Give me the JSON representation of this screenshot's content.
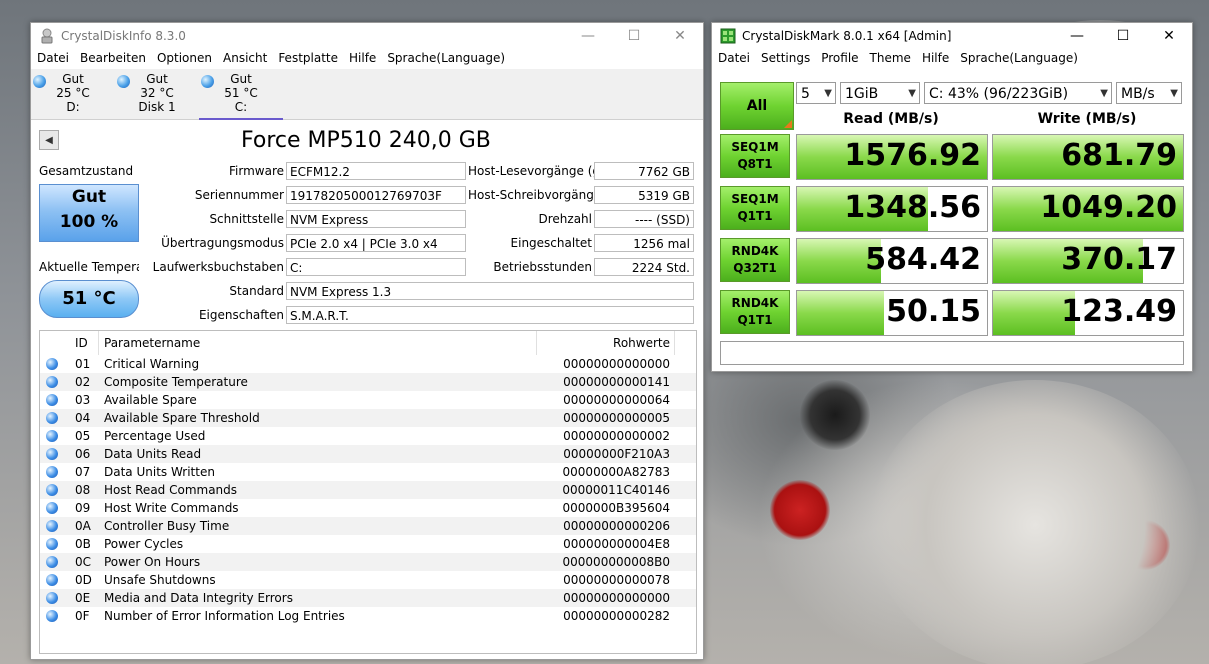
{
  "cdi": {
    "title": "CrystalDiskInfo 8.3.0",
    "menu": [
      "Datei",
      "Bearbeiten",
      "Optionen",
      "Ansicht",
      "Festplatte",
      "Hilfe",
      "Sprache(Language)"
    ],
    "disks": [
      {
        "status": "Gut",
        "temp": "25 °C",
        "name": "D:"
      },
      {
        "status": "Gut",
        "temp": "32 °C",
        "name": "Disk 1"
      },
      {
        "status": "Gut",
        "temp": "51 °C",
        "name": "C:"
      }
    ],
    "drive_title": "Force MP510 240,0 GB",
    "health_label": "Gesamtzustand",
    "health_status": "Gut",
    "health_percent": "100 %",
    "temp_label": "Aktuelle Temperatur",
    "temp_value": "51 °C",
    "fields_left": [
      {
        "label": "Firmware",
        "value": "ECFM12.2"
      },
      {
        "label": "Seriennummer",
        "value": "1917820500012769703F"
      },
      {
        "label": "Schnittstelle",
        "value": "NVM Express"
      },
      {
        "label": "Übertragungsmodus",
        "value": "PCIe 2.0 x4 | PCIe 3.0 x4"
      },
      {
        "label": "Laufwerksbuchstaben",
        "value": "C:"
      }
    ],
    "fields_right": [
      {
        "label": "Host-Lesevorgänge (gesamt)",
        "value": "7762 GB"
      },
      {
        "label": "Host-Schreibvorgänge (gesamt)",
        "value": "5319 GB"
      },
      {
        "label": "Drehzahl",
        "value": "---- (SSD)"
      },
      {
        "label": "Eingeschaltet",
        "value": "1256 mal"
      },
      {
        "label": "Betriebsstunden",
        "value": "2224 Std."
      }
    ],
    "standard_label": "Standard",
    "standard_value": "NVM Express 1.3",
    "features_label": "Eigenschaften",
    "features_value": "S.M.A.R.T.",
    "table_headers": {
      "id": "ID",
      "name": "Parametername",
      "raw": "Rohwerte"
    },
    "attributes": [
      {
        "id": "01",
        "name": "Critical Warning",
        "raw": "00000000000000"
      },
      {
        "id": "02",
        "name": "Composite Temperature",
        "raw": "00000000000141"
      },
      {
        "id": "03",
        "name": "Available Spare",
        "raw": "00000000000064"
      },
      {
        "id": "04",
        "name": "Available Spare Threshold",
        "raw": "00000000000005"
      },
      {
        "id": "05",
        "name": "Percentage Used",
        "raw": "00000000000002"
      },
      {
        "id": "06",
        "name": "Data Units Read",
        "raw": "00000000F210A3"
      },
      {
        "id": "07",
        "name": "Data Units Written",
        "raw": "00000000A82783"
      },
      {
        "id": "08",
        "name": "Host Read Commands",
        "raw": "00000011C40146"
      },
      {
        "id": "09",
        "name": "Host Write Commands",
        "raw": "0000000B395604"
      },
      {
        "id": "0A",
        "name": "Controller Busy Time",
        "raw": "00000000000206"
      },
      {
        "id": "0B",
        "name": "Power Cycles",
        "raw": "000000000004E8"
      },
      {
        "id": "0C",
        "name": "Power On Hours",
        "raw": "000000000008B0"
      },
      {
        "id": "0D",
        "name": "Unsafe Shutdowns",
        "raw": "00000000000078"
      },
      {
        "id": "0E",
        "name": "Media and Data Integrity Errors",
        "raw": "00000000000000"
      },
      {
        "id": "0F",
        "name": "Number of Error Information Log Entries",
        "raw": "00000000000282"
      }
    ]
  },
  "cdm": {
    "title": "CrystalDiskMark 8.0.1 x64 [Admin]",
    "menu": [
      "Datei",
      "Settings",
      "Profile",
      "Theme",
      "Hilfe",
      "Sprache(Language)"
    ],
    "all_label": "All",
    "count": "5",
    "size": "1GiB",
    "drive": "C: 43% (96/223GiB)",
    "unit": "MB/s",
    "read_header": "Read (MB/s)",
    "write_header": "Write (MB/s)",
    "tests": [
      {
        "l1": "SEQ1M",
        "l2": "Q8T1",
        "read": "1576.92",
        "write": "681.79",
        "read_fill": 1.0,
        "write_fill": 1.0
      },
      {
        "l1": "SEQ1M",
        "l2": "Q1T1",
        "read": "1348.56",
        "write": "1049.20",
        "read_fill": 0.69,
        "write_fill": 1.0
      },
      {
        "l1": "RND4K",
        "l2": "Q32T1",
        "read": "584.42",
        "write": "370.17",
        "read_fill": 0.44,
        "write_fill": 0.79
      },
      {
        "l1": "RND4K",
        "l2": "Q1T1",
        "read": "50.15",
        "write": "123.49",
        "read_fill": 0.46,
        "write_fill": 0.43
      }
    ],
    "colors": {
      "green": "#6fd331",
      "corner": "#e8771c"
    }
  }
}
